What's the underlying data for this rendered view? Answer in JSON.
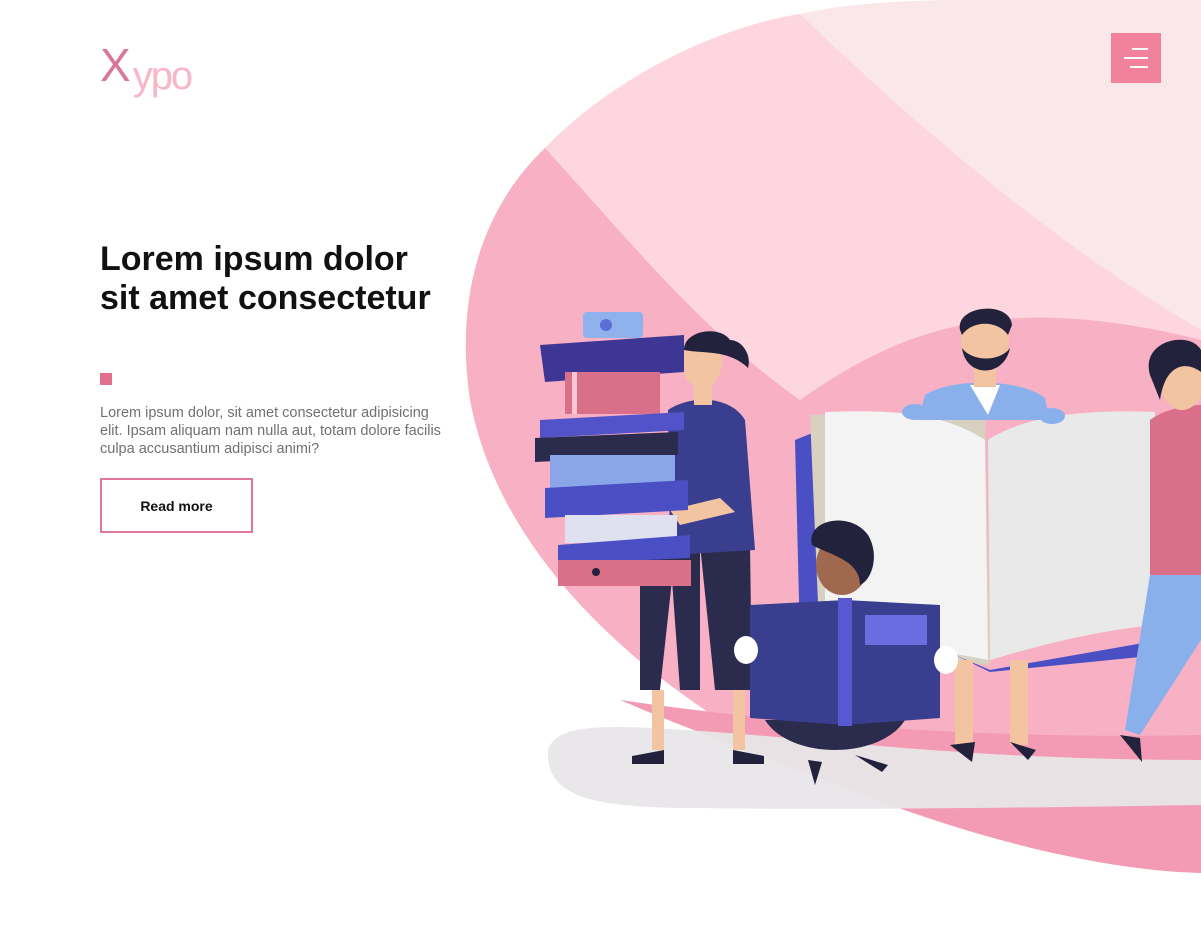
{
  "brand": {
    "logo_initial": "X",
    "logo_rest": "ypo"
  },
  "header": {
    "menu_icon": "hamburger-menu-icon"
  },
  "hero": {
    "title": "Lorem ipsum dolor sit amet consectetur",
    "text": "Lorem ipsum dolor, sit amet consectetur adipisicing elit. Ipsam aliquam nam nulla aut, totam dolore facilis culpa accusantium adipisci animi?",
    "button_label": "Read more"
  },
  "colors": {
    "accent": "#e0708e",
    "menu_button": "#f2829b",
    "blob_dark": "#f8b0c4",
    "blob_mid": "#fdd6df",
    "blob_light": "#f9e7ea"
  },
  "illustration": {
    "subject": "people-reading-books-illustration"
  }
}
